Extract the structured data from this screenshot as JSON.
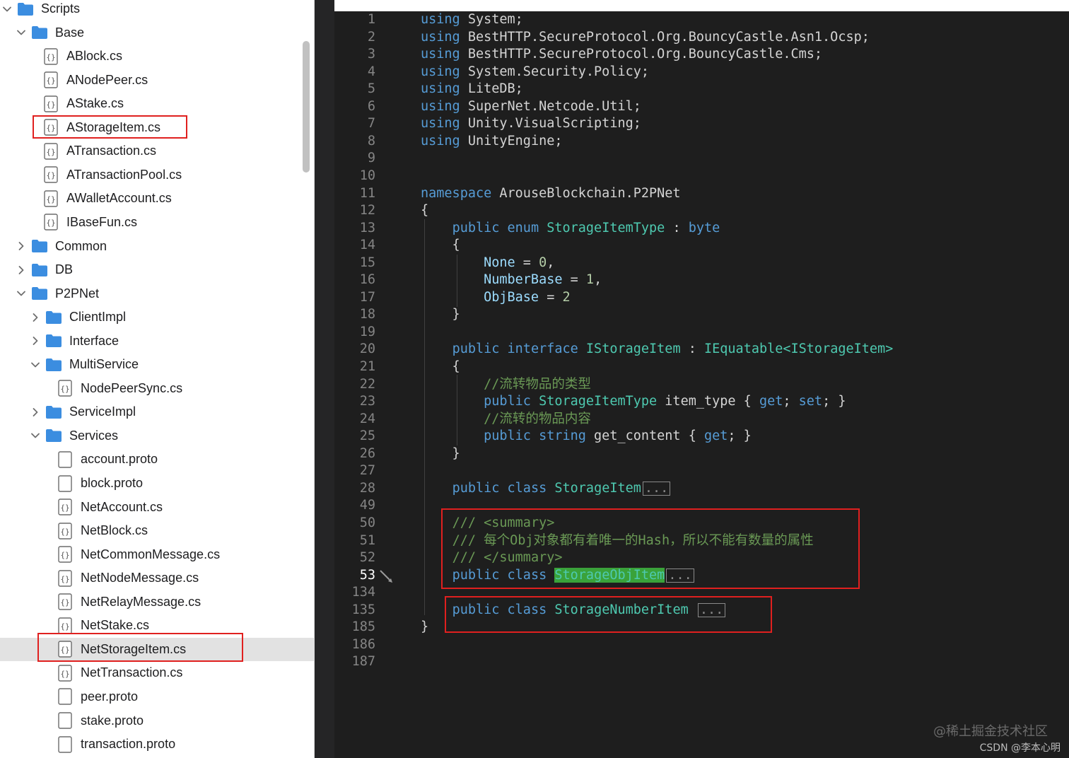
{
  "sidebar": {
    "items": [
      {
        "label": "Scripts",
        "type": "folder",
        "expanded": true
      },
      {
        "label": "Base",
        "type": "folder",
        "expanded": true
      },
      {
        "label": "ABlock.cs",
        "type": "cs"
      },
      {
        "label": "ANodePeer.cs",
        "type": "cs"
      },
      {
        "label": "AStake.cs",
        "type": "cs"
      },
      {
        "label": "AStorageItem.cs",
        "type": "cs"
      },
      {
        "label": "ATransaction.cs",
        "type": "cs"
      },
      {
        "label": "ATransactionPool.cs",
        "type": "cs"
      },
      {
        "label": "AWalletAccount.cs",
        "type": "cs"
      },
      {
        "label": "IBaseFun.cs",
        "type": "cs"
      },
      {
        "label": "Common",
        "type": "folder",
        "expanded": false
      },
      {
        "label": "DB",
        "type": "folder",
        "expanded": false
      },
      {
        "label": "P2PNet",
        "type": "folder",
        "expanded": true
      },
      {
        "label": "ClientImpl",
        "type": "folder",
        "expanded": false
      },
      {
        "label": "Interface",
        "type": "folder",
        "expanded": false
      },
      {
        "label": "MultiService",
        "type": "folder",
        "expanded": true
      },
      {
        "label": "NodePeerSync.cs",
        "type": "cs"
      },
      {
        "label": "ServiceImpl",
        "type": "folder",
        "expanded": false
      },
      {
        "label": "Services",
        "type": "folder",
        "expanded": true
      },
      {
        "label": "account.proto",
        "type": "proto"
      },
      {
        "label": "block.proto",
        "type": "proto"
      },
      {
        "label": "NetAccount.cs",
        "type": "cs"
      },
      {
        "label": "NetBlock.cs",
        "type": "cs"
      },
      {
        "label": "NetCommonMessage.cs",
        "type": "cs"
      },
      {
        "label": "NetNodeMessage.cs",
        "type": "cs"
      },
      {
        "label": "NetRelayMessage.cs",
        "type": "cs"
      },
      {
        "label": "NetStake.cs",
        "type": "cs"
      },
      {
        "label": "NetStorageItem.cs",
        "type": "cs",
        "selected": true
      },
      {
        "label": "NetTransaction.cs",
        "type": "cs"
      },
      {
        "label": "peer.proto",
        "type": "proto"
      },
      {
        "label": "stake.proto",
        "type": "proto"
      },
      {
        "label": "transaction.proto",
        "type": "proto"
      }
    ]
  },
  "editor": {
    "active_line": "53",
    "lines": [
      {
        "n": "1",
        "tokens": [
          [
            "kw",
            "using"
          ],
          [
            "tx",
            " System;"
          ]
        ]
      },
      {
        "n": "2",
        "tokens": [
          [
            "kw",
            "using"
          ],
          [
            "tx",
            " BestHTTP.SecureProtocol.Org.BouncyCastle.Asn1.Ocsp;"
          ]
        ]
      },
      {
        "n": "3",
        "tokens": [
          [
            "kw",
            "using"
          ],
          [
            "tx",
            " BestHTTP.SecureProtocol.Org.BouncyCastle.Cms;"
          ]
        ]
      },
      {
        "n": "4",
        "tokens": [
          [
            "kw",
            "using"
          ],
          [
            "tx",
            " System.Security.Policy;"
          ]
        ]
      },
      {
        "n": "5",
        "tokens": [
          [
            "kw",
            "using"
          ],
          [
            "tx",
            " LiteDB;"
          ]
        ]
      },
      {
        "n": "6",
        "tokens": [
          [
            "kw",
            "using"
          ],
          [
            "tx",
            " SuperNet.Netcode.Util;"
          ]
        ]
      },
      {
        "n": "7",
        "tokens": [
          [
            "kw",
            "using"
          ],
          [
            "tx",
            " Unity.VisualScripting;"
          ]
        ]
      },
      {
        "n": "8",
        "tokens": [
          [
            "kw",
            "using"
          ],
          [
            "tx",
            " UnityEngine;"
          ]
        ]
      },
      {
        "n": "9",
        "tokens": []
      },
      {
        "n": "10",
        "tokens": []
      },
      {
        "n": "11",
        "tokens": [
          [
            "kw",
            "namespace"
          ],
          [
            "tx",
            " ArouseBlockchain.P2PNet"
          ]
        ]
      },
      {
        "n": "12",
        "tokens": [
          [
            "tx",
            "{"
          ]
        ]
      },
      {
        "n": "13",
        "tokens": [
          [
            "tx",
            "    "
          ],
          [
            "kw",
            "public"
          ],
          [
            "tx",
            " "
          ],
          [
            "kw",
            "enum"
          ],
          [
            "tx",
            " "
          ],
          [
            "ty",
            "StorageItemType"
          ],
          [
            "tx",
            " : "
          ],
          [
            "kw",
            "byte"
          ]
        ]
      },
      {
        "n": "14",
        "tokens": [
          [
            "tx",
            "    {"
          ]
        ]
      },
      {
        "n": "15",
        "tokens": [
          [
            "tx",
            "        "
          ],
          [
            "en",
            "None"
          ],
          [
            "tx",
            " = "
          ],
          [
            "nm",
            "0"
          ],
          [
            "tx",
            ","
          ]
        ]
      },
      {
        "n": "16",
        "tokens": [
          [
            "tx",
            "        "
          ],
          [
            "en",
            "NumberBase"
          ],
          [
            "tx",
            " = "
          ],
          [
            "nm",
            "1"
          ],
          [
            "tx",
            ","
          ]
        ]
      },
      {
        "n": "17",
        "tokens": [
          [
            "tx",
            "        "
          ],
          [
            "en",
            "ObjBase"
          ],
          [
            "tx",
            " = "
          ],
          [
            "nm",
            "2"
          ]
        ]
      },
      {
        "n": "18",
        "tokens": [
          [
            "tx",
            "    }"
          ]
        ]
      },
      {
        "n": "19",
        "tokens": []
      },
      {
        "n": "20",
        "tokens": [
          [
            "tx",
            "    "
          ],
          [
            "kw",
            "public"
          ],
          [
            "tx",
            " "
          ],
          [
            "kw",
            "interface"
          ],
          [
            "tx",
            " "
          ],
          [
            "ty",
            "IStorageItem"
          ],
          [
            "tx",
            " : "
          ],
          [
            "ty",
            "IEquatable<IStorageItem>"
          ]
        ]
      },
      {
        "n": "21",
        "tokens": [
          [
            "tx",
            "    {"
          ]
        ]
      },
      {
        "n": "22",
        "tokens": [
          [
            "tx",
            "        "
          ],
          [
            "cm",
            "//流转物品的类型"
          ]
        ]
      },
      {
        "n": "23",
        "tokens": [
          [
            "tx",
            "        "
          ],
          [
            "kw",
            "public"
          ],
          [
            "tx",
            " "
          ],
          [
            "ty",
            "StorageItemType"
          ],
          [
            "tx",
            " item_type { "
          ],
          [
            "kw",
            "get"
          ],
          [
            "tx",
            "; "
          ],
          [
            "kw",
            "set"
          ],
          [
            "tx",
            "; }"
          ]
        ]
      },
      {
        "n": "24",
        "tokens": [
          [
            "tx",
            "        "
          ],
          [
            "cm",
            "//流转的物品内容"
          ]
        ]
      },
      {
        "n": "25",
        "tokens": [
          [
            "tx",
            "        "
          ],
          [
            "kw",
            "public"
          ],
          [
            "tx",
            " "
          ],
          [
            "kw",
            "string"
          ],
          [
            "tx",
            " get_content { "
          ],
          [
            "kw",
            "get"
          ],
          [
            "tx",
            "; }"
          ]
        ]
      },
      {
        "n": "26",
        "tokens": [
          [
            "tx",
            "    }"
          ]
        ]
      },
      {
        "n": "27",
        "tokens": []
      },
      {
        "n": "28",
        "tokens": [
          [
            "tx",
            "    "
          ],
          [
            "kw",
            "public"
          ],
          [
            "tx",
            " "
          ],
          [
            "kw",
            "class"
          ],
          [
            "tx",
            " "
          ],
          [
            "ty",
            "StorageItem"
          ],
          [
            "fold",
            "..."
          ]
        ]
      },
      {
        "n": "49",
        "tokens": []
      },
      {
        "n": "50",
        "tokens": [
          [
            "tx",
            "    "
          ],
          [
            "cm",
            "/// <summary>"
          ]
        ]
      },
      {
        "n": "51",
        "tokens": [
          [
            "tx",
            "    "
          ],
          [
            "cm",
            "/// 每个Obj对象都有着唯一的Hash，所以不能有数量的属性"
          ]
        ]
      },
      {
        "n": "52",
        "tokens": [
          [
            "tx",
            "    "
          ],
          [
            "cm",
            "/// </summary>"
          ]
        ]
      },
      {
        "n": "53",
        "tokens": [
          [
            "tx",
            "    "
          ],
          [
            "kw",
            "public"
          ],
          [
            "tx",
            " "
          ],
          [
            "kw",
            "class"
          ],
          [
            "tx",
            " "
          ],
          [
            "hl",
            "StorageObjItem"
          ],
          [
            "fold",
            "..."
          ]
        ]
      },
      {
        "n": "134",
        "tokens": []
      },
      {
        "n": "135",
        "tokens": [
          [
            "tx",
            "    "
          ],
          [
            "kw",
            "public"
          ],
          [
            "tx",
            " "
          ],
          [
            "kw",
            "class"
          ],
          [
            "tx",
            " "
          ],
          [
            "ty",
            "StorageNumberItem"
          ],
          [
            "tx",
            " "
          ],
          [
            "fold",
            "..."
          ]
        ]
      },
      {
        "n": "185",
        "tokens": [
          [
            "tx",
            "}"
          ]
        ]
      },
      {
        "n": "186",
        "tokens": []
      },
      {
        "n": "187",
        "tokens": []
      }
    ]
  },
  "watermark": {
    "line1": "@稀土掘金技术社区",
    "line2": "CSDN @李本心明"
  },
  "colors": {
    "highlight_box": "#e0201f",
    "folder": "#3b8de0",
    "editor_bg": "#1e1e1e"
  }
}
